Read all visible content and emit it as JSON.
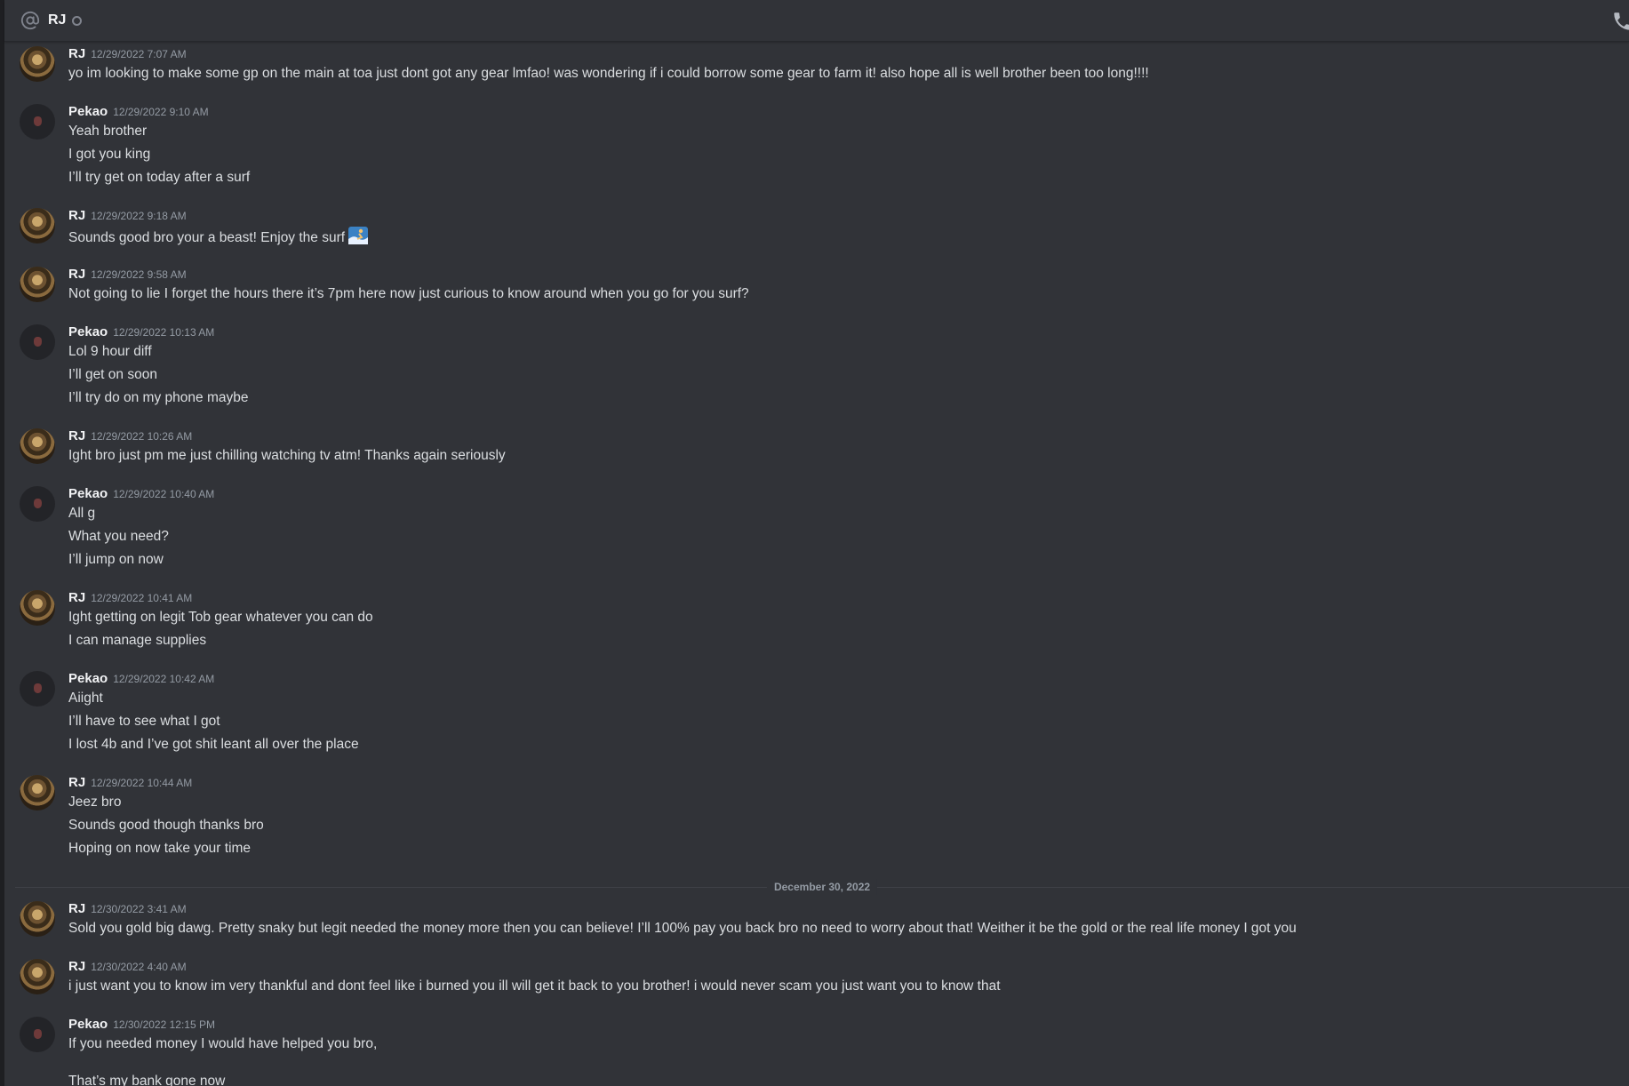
{
  "header": {
    "name": "RJ"
  },
  "divider": {
    "label": "December 30, 2022"
  },
  "messages": [
    {
      "author": "RJ",
      "time": "12/29/2022 7:07 AM",
      "lines": [
        "yo im looking to make some gp on the main at toa just dont got any gear lmfao! was wondering if i could borrow some gear to farm it! also hope all is well brother been too long!!!!"
      ]
    },
    {
      "author": "Pekao",
      "time": "12/29/2022 9:10 AM",
      "lines": [
        "Yeah brother",
        "I got you king",
        "I’ll try get on today after a surf"
      ]
    },
    {
      "author": "RJ",
      "time": "12/29/2022 9:18 AM",
      "lines": [
        "Sounds good bro your a beast! Enjoy the surf"
      ],
      "emoji": "surfer-emoji"
    },
    {
      "author": "RJ",
      "time": "12/29/2022 9:58 AM",
      "lines": [
        "Not going to lie I forget the hours there it’s 7pm here now just curious to know around when you go for you surf?"
      ]
    },
    {
      "author": "Pekao",
      "time": "12/29/2022 10:13 AM",
      "lines": [
        "Lol 9 hour diff",
        "I’ll get on soon",
        "I’ll try do on my phone maybe"
      ]
    },
    {
      "author": "RJ",
      "time": "12/29/2022 10:26 AM",
      "lines": [
        "Ight bro just pm me just chilling watching tv atm! Thanks again seriously"
      ]
    },
    {
      "author": "Pekao",
      "time": "12/29/2022 10:40 AM",
      "lines": [
        "All g",
        "What you need?",
        "I’ll jump on now"
      ]
    },
    {
      "author": "RJ",
      "time": "12/29/2022 10:41 AM",
      "lines": [
        "Ight getting on legit Tob gear whatever you can do",
        "I can manage supplies"
      ]
    },
    {
      "author": "Pekao",
      "time": "12/29/2022 10:42 AM",
      "lines": [
        "Aiight",
        "I’ll have to see what I got",
        "I lost 4b and I’ve got shit leant all over the place"
      ]
    },
    {
      "author": "RJ",
      "time": "12/29/2022 10:44 AM",
      "lines": [
        "Jeez bro",
        "Sounds good though thanks bro",
        "Hoping on now take your time"
      ]
    },
    {
      "author": "RJ",
      "time": "12/30/2022 3:41 AM",
      "lines": [
        "Sold you gold big dawg. Pretty snaky but legit needed the money more then you can believe! I’ll 100% pay you back bro no need to worry about that! Weither it be the gold or the real life money I got you"
      ]
    },
    {
      "author": "RJ",
      "time": "12/30/2022 4:40 AM",
      "lines": [
        "i just want you to know im very thankful and dont feel like i burned you ill will get it back to you brother! i would never scam you just want you to know that"
      ]
    },
    {
      "author": "Pekao",
      "time": "12/30/2022 12:15 PM",
      "lines": [
        "If you needed money I would have helped you bro,",
        "",
        "That’s my bank gone now"
      ]
    }
  ]
}
